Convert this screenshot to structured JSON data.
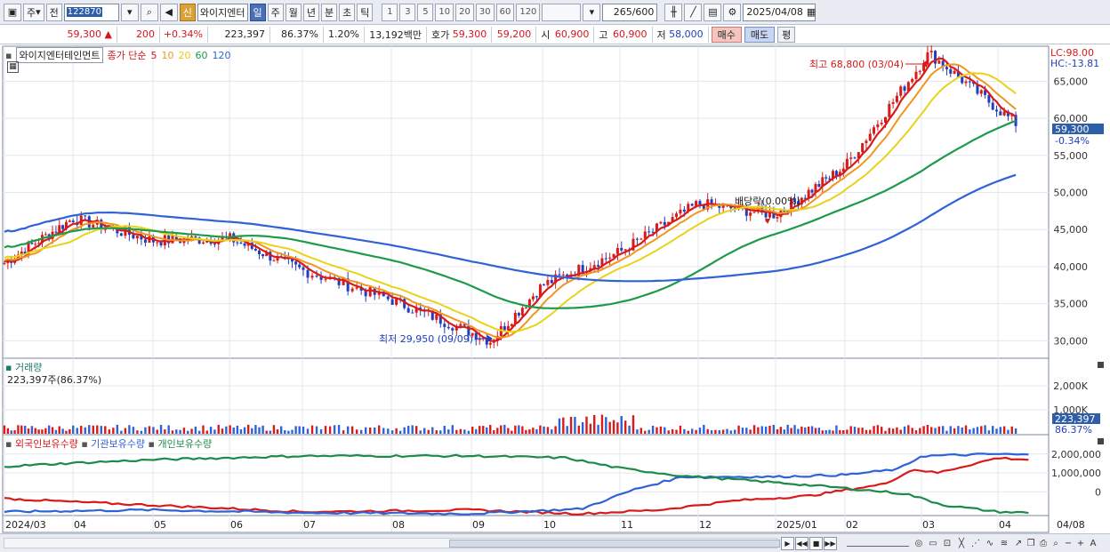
{
  "toolbar": {
    "period_label": "주",
    "jeon_label": "전",
    "code": "122870",
    "sin_label": "신",
    "stock_name": "와이지엔터",
    "units": [
      "일",
      "주",
      "월",
      "년",
      "분",
      "초",
      "틱"
    ],
    "active_unit": "일",
    "minutes": [
      "1",
      "3",
      "5",
      "10",
      "20",
      "30",
      "60",
      "120"
    ],
    "count": "265",
    "count_total": "/600",
    "date": "2025/04/08"
  },
  "quote": {
    "price": "59,300",
    "change": "200",
    "change_pct": "+0.34%",
    "volume": "223,397",
    "volume_ratio": "86.37%",
    "turnover_pct": "1.20%",
    "amount": "13,192백만",
    "ask_label": "호가",
    "ask": "59,300",
    "bid": "59,200",
    "open_label": "시",
    "open": "60,900",
    "high_label": "고",
    "high": "60,900",
    "low_label": "저",
    "low": "58,000",
    "buy_label": "매수",
    "sell_label": "매도",
    "extra_label": "평"
  },
  "legend": {
    "name": "와이지엔터테인먼트",
    "series": "종가 단순",
    "ma": [
      {
        "label": "5",
        "color": "#d91a1a"
      },
      {
        "label": "10",
        "color": "#f0961e"
      },
      {
        "label": "20",
        "color": "#e8d31a"
      },
      {
        "label": "60",
        "color": "#1e9a4a"
      },
      {
        "label": "120",
        "color": "#2f62d6"
      }
    ]
  },
  "labels": {
    "lc": "LC:98.00",
    "hc": "HC:-13.81",
    "high_note": "최고 68,800 (03/04)",
    "low_note": "최저 29,950 (09/09)",
    "dividend_note": "배당락(0.00%)",
    "current_price": "59,300",
    "current_change": "-0.34%",
    "volume_title": "거래량",
    "volume_value": "223,397주(86.37%)",
    "volume_tag": "223,397",
    "volume_tag_pct": "86.37%",
    "holdings": [
      {
        "label": "외국인보유수량",
        "color": "#d91a1a"
      },
      {
        "label": "기관보유수량",
        "color": "#2f62d6"
      },
      {
        "label": "개인보유수량",
        "color": "#1e8a4a"
      }
    ]
  },
  "axes": {
    "price_ticks": [
      "65,000",
      "60,000",
      "55,000",
      "50,000",
      "45,000",
      "40,000",
      "35,000",
      "30,000"
    ],
    "volume_ticks": [
      "2,000K",
      "1,000K"
    ],
    "holding_ticks": [
      "2,000,000",
      "1,000,000",
      "0"
    ],
    "x_ticks": [
      "2024/03",
      "04",
      "05",
      "06",
      "07",
      "08",
      "09",
      "10",
      "11",
      "12",
      "2025/01",
      "02",
      "03",
      "04",
      "04/08"
    ]
  },
  "chart_data": {
    "type": "line",
    "title": "와이지엔터테인먼트",
    "x_range": [
      "2024/03",
      "2025/04/08"
    ],
    "price": {
      "ylim": [
        28000,
        69000
      ],
      "close_approx": [
        {
          "x": "2024/03",
          "y": 40500
        },
        {
          "x": "2024/04",
          "y": 46500
        },
        {
          "x": "2024/05",
          "y": 43500
        },
        {
          "x": "2024/06",
          "y": 43800
        },
        {
          "x": "2024/07",
          "y": 39500
        },
        {
          "x": "2024/08",
          "y": 35500
        },
        {
          "x": "2024/09/09",
          "y": 29950
        },
        {
          "x": "2024/10",
          "y": 37500
        },
        {
          "x": "2024/11",
          "y": 42000
        },
        {
          "x": "2024/12",
          "y": 48500
        },
        {
          "x": "2025/01",
          "y": 47000
        },
        {
          "x": "2025/02",
          "y": 53500
        },
        {
          "x": "2025/03/04",
          "y": 68800
        },
        {
          "x": "2025/04/08",
          "y": 59300
        }
      ],
      "series": [
        {
          "name": "5",
          "color": "#d91a1a"
        },
        {
          "name": "10",
          "color": "#f0961e"
        },
        {
          "name": "20",
          "color": "#e8d31a"
        },
        {
          "name": "60",
          "color": "#1e9a4a"
        },
        {
          "name": "120",
          "color": "#2f62d6"
        }
      ],
      "annotations": [
        {
          "text": "최고 68,800 (03/04)",
          "x": "2025/03/04",
          "y": 68800
        },
        {
          "text": "최저 29,950 (09/09)",
          "x": "2024/09/09",
          "y": 29950
        },
        {
          "text": "배당락(0.00%)",
          "x": "2024/12",
          "y": 48800
        }
      ]
    },
    "volume": {
      "ylim": [
        0,
        2600000
      ],
      "peak": {
        "x": "2025/02",
        "y": 2650000
      },
      "last": 223397
    },
    "holdings": {
      "ylim": [
        -1200000,
        2600000
      ],
      "series": [
        {
          "name": "외국인보유수량",
          "color": "#d91a1a"
        },
        {
          "name": "기관보유수량",
          "color": "#2f62d6"
        },
        {
          "name": "개인보유수량",
          "color": "#1e8a4a"
        }
      ]
    }
  }
}
